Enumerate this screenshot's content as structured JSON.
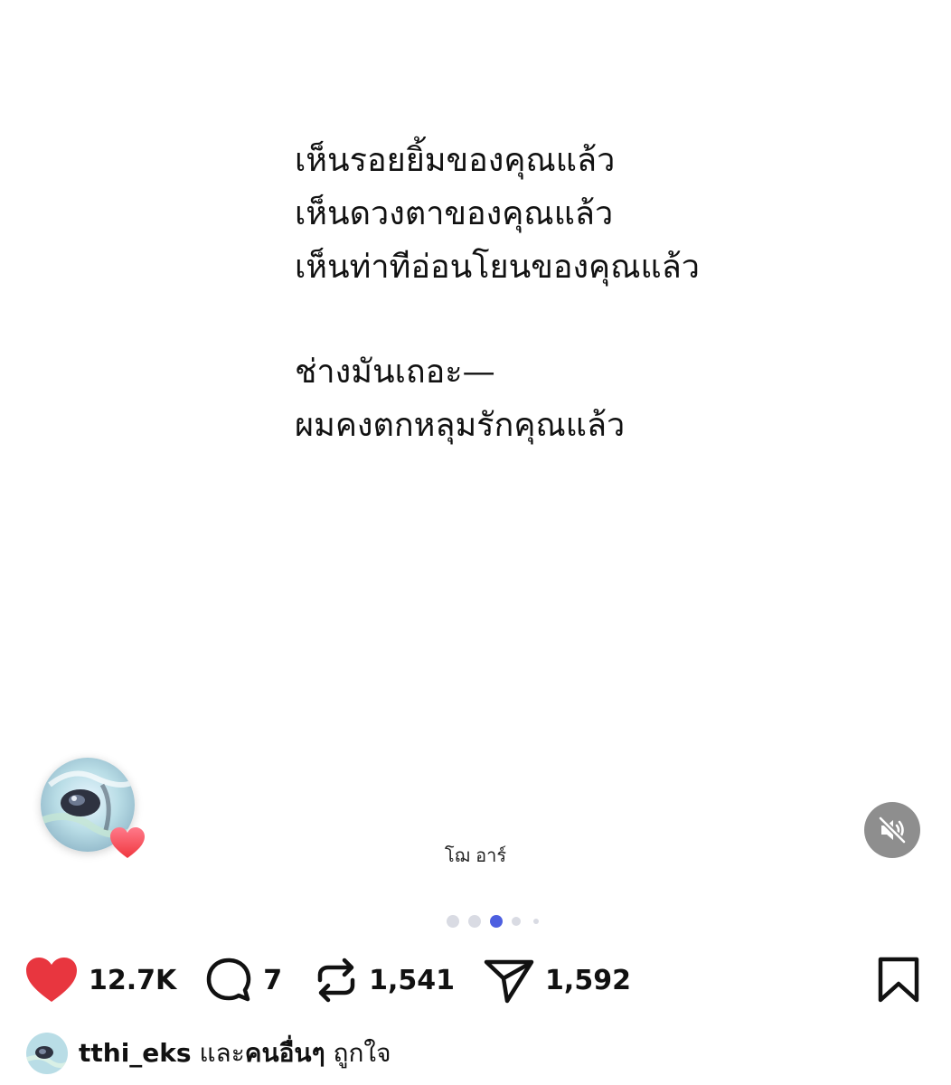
{
  "poem": {
    "lines": [
      "เห็นรอยยิ้มของคุณแล้ว",
      "เห็นดวงตาของคุณแล้ว",
      "เห็นท่าทีอ่อนโยนของคุณแล้ว",
      "ช่างมันเถอะ—",
      "ผมคงตกหลุมรักคุณแล้ว"
    ]
  },
  "author": "โฌ อาร์",
  "media": {
    "mute_icon": "speaker-muted-icon",
    "carousel": {
      "total": 5,
      "active_index": 3
    }
  },
  "actions": {
    "likes": "12.7K",
    "comments": "7",
    "reposts": "1,541",
    "shares": "1,592"
  },
  "liked_by": {
    "username": "tthi_eks",
    "connector": "และ",
    "others": "คนอื่นๆ",
    "suffix": "ถูกใจ"
  },
  "colors": {
    "like_red": "#e8363f",
    "carousel_active": "#4d5fe0",
    "mute_bg": "#8e8e8e"
  }
}
